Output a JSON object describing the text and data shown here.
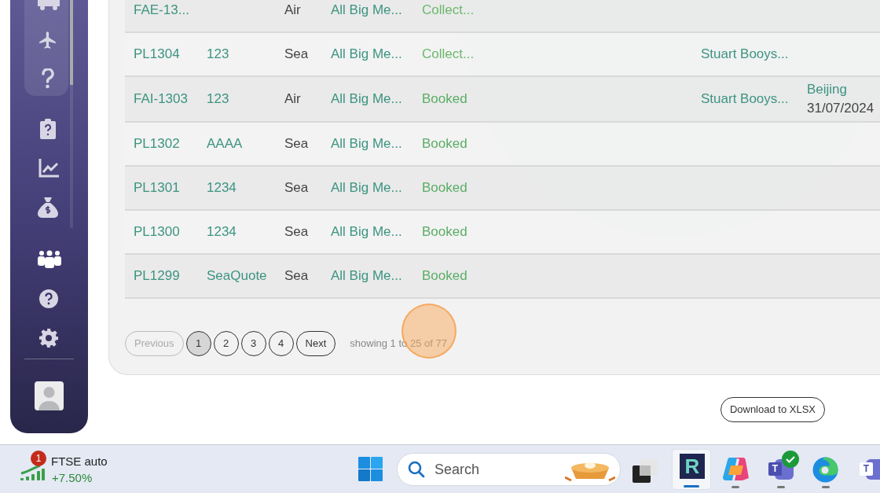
{
  "table": {
    "rows": [
      {
        "id": "FAE-13...",
        "ref": "",
        "mode": "Air",
        "customer": "All Big Me...",
        "status": "Collect...",
        "kind": "collect",
        "contact": "",
        "location": "",
        "date": ""
      },
      {
        "id": "PL1304",
        "ref": "123",
        "mode": "Sea",
        "customer": "All Big Me...",
        "status": "Collect...",
        "kind": "collect",
        "contact": "Stuart Booys...",
        "location": "",
        "date": ""
      },
      {
        "id": "FAI-1303",
        "ref": "123",
        "mode": "Air",
        "customer": "All Big Me...",
        "status": "Booked",
        "kind": "booked",
        "contact": "Stuart Booys...",
        "location": "Beijing",
        "date": "31/07/2024"
      },
      {
        "id": "PL1302",
        "ref": "AAAA",
        "mode": "Sea",
        "customer": "All Big Me...",
        "status": "Booked",
        "kind": "booked",
        "contact": "",
        "location": "",
        "date": ""
      },
      {
        "id": "PL1301",
        "ref": "1234",
        "mode": "Sea",
        "customer": "All Big Me...",
        "status": "Booked",
        "kind": "booked",
        "contact": "",
        "location": "",
        "date": ""
      },
      {
        "id": "PL1300",
        "ref": "1234",
        "mode": "Sea",
        "customer": "All Big Me...",
        "status": "Booked",
        "kind": "booked",
        "contact": "",
        "location": "",
        "date": ""
      },
      {
        "id": "PL1299",
        "ref": "SeaQuote",
        "mode": "Sea",
        "customer": "All Big Me...",
        "status": "Booked",
        "kind": "booked",
        "contact": "",
        "location": "",
        "date": ""
      }
    ]
  },
  "pagination": {
    "buttons": [
      {
        "label": "Previous",
        "selected": false,
        "disabled": true
      },
      {
        "label": "1",
        "selected": true,
        "disabled": false
      },
      {
        "label": "2",
        "selected": false,
        "disabled": false
      },
      {
        "label": "3",
        "selected": false,
        "disabled": false
      },
      {
        "label": "4",
        "selected": false,
        "disabled": false
      },
      {
        "label": "Next",
        "selected": false,
        "disabled": false
      }
    ],
    "summary": "showing 1 to 25 of 77"
  },
  "download_button": "Download to XLSX",
  "taskbar": {
    "widget": {
      "badge": "1",
      "title": "FTSE auto",
      "change": "+7.50%"
    },
    "search_placeholder": "Search",
    "app_letter": "R",
    "teams_letter": "T",
    "teams2_letter": "T"
  }
}
